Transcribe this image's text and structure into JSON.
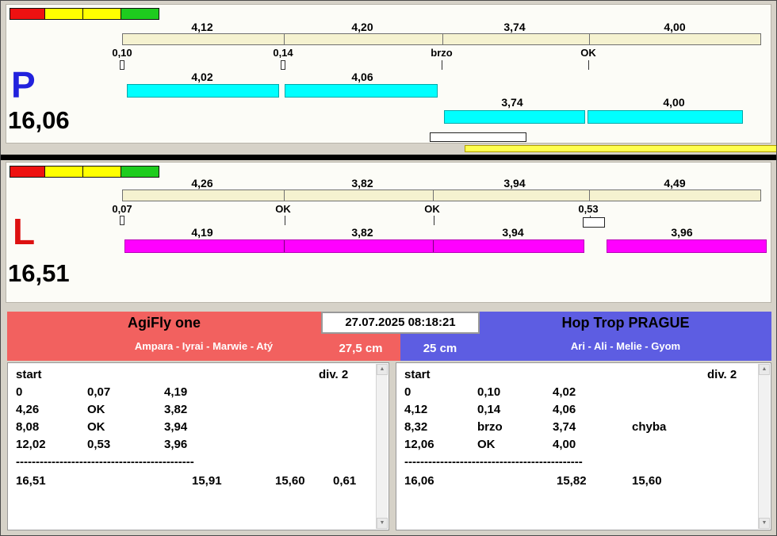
{
  "colors": {
    "bg": "#d6d2c8",
    "panel": "#fcfcf7",
    "cream": "#f5f2d0",
    "cyan": "#00ffff",
    "magenta": "#ff00ff",
    "yellow": "#ffff4f",
    "seg-red": "#ee1111",
    "seg-yellow": "#ffff00",
    "seg-green": "#1ecc1e",
    "p-color": "#2222dd",
    "l-color": "#dd1111",
    "team-left-color": "#f2615f",
    "team-right-color": "#5d5de2"
  },
  "icons": {
    "scroll_up": "▲",
    "scroll_down": "▼"
  },
  "lane_p": {
    "letter": "P",
    "total": "16,06",
    "splits": [
      "4,12",
      "4,20",
      "3,74",
      "4,00"
    ],
    "changes": [
      "0,10",
      "0,14",
      "brzo",
      "OK"
    ],
    "runs_row1": [
      "4,02",
      "4,06"
    ],
    "runs_row2": [
      "3,74",
      "4,00"
    ]
  },
  "lane_l": {
    "letter": "L",
    "total": "16,51",
    "splits": [
      "4,26",
      "3,82",
      "3,94",
      "4,49"
    ],
    "changes": [
      "0,07",
      "OK",
      "OK",
      "0,53"
    ],
    "runs": [
      "4,19",
      "3,82",
      "3,94",
      "3,96"
    ]
  },
  "timestamp": "27.07.2025 08:18:21",
  "team_left": {
    "name": "AgiFly one",
    "members": "Ampara - Iyrai - Marwie - Atý",
    "jump_height": "27,5 cm",
    "table": {
      "start_label": "start",
      "division": "div. 2",
      "rows": [
        [
          "0",
          "0,07",
          "4,19",
          ""
        ],
        [
          "4,26",
          "OK",
          "3,82",
          ""
        ],
        [
          "8,08",
          "OK",
          "3,94",
          ""
        ],
        [
          "12,02",
          "0,53",
          "3,96",
          ""
        ]
      ],
      "separator": "---------------------------------------------",
      "totals": [
        "16,51",
        "15,91",
        "15,60",
        "0,61"
      ]
    }
  },
  "team_right": {
    "name": "Hop Trop PRAGUE",
    "members": "Ari - Ali - Melie - Gyom",
    "jump_height": "25 cm",
    "table": {
      "start_label": "start",
      "division": "div. 2",
      "rows": [
        [
          "0",
          "0,10",
          "4,02",
          ""
        ],
        [
          "4,12",
          "0,14",
          "4,06",
          ""
        ],
        [
          "8,32",
          "brzo",
          "3,74",
          "chyba"
        ],
        [
          "12,06",
          "OK",
          "4,00",
          ""
        ]
      ],
      "separator": "---------------------------------------------",
      "totals": [
        "16,06",
        "15,82",
        "15,60",
        ""
      ]
    }
  }
}
